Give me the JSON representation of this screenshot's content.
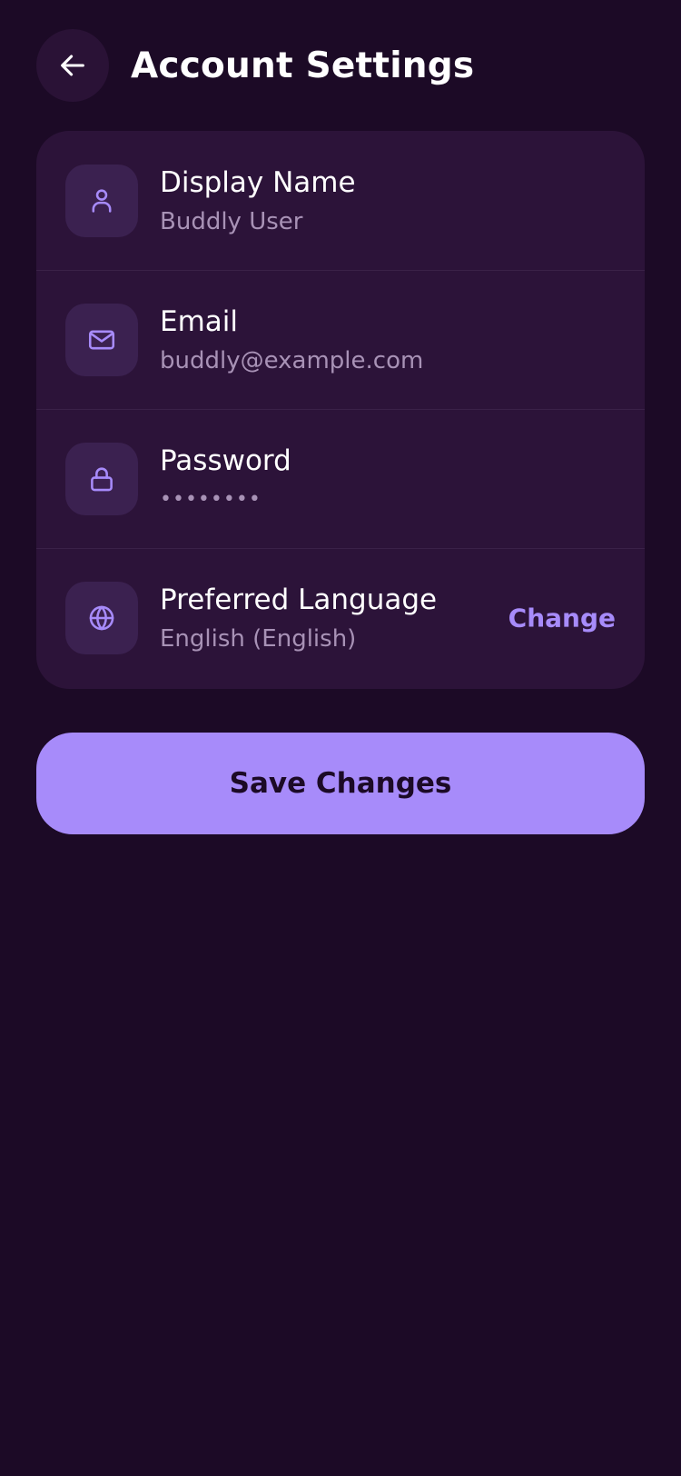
{
  "header": {
    "title": "Account Settings",
    "back_icon": "arrow-left-icon"
  },
  "settings": {
    "items": [
      {
        "icon": "user-icon",
        "label": "Display Name",
        "value": "Buddly User"
      },
      {
        "icon": "mail-icon",
        "label": "Email",
        "value": "buddly@example.com"
      },
      {
        "icon": "lock-icon",
        "label": "Password",
        "value": "••••••••"
      },
      {
        "icon": "globe-icon",
        "label": "Preferred Language",
        "value": "English (English)",
        "action": "Change"
      }
    ]
  },
  "actions": {
    "save_label": "Save Changes"
  },
  "colors": {
    "background": "#1c0a26",
    "card": "#2c1339",
    "accent": "#a78bfa",
    "muted_text": "#a892b6"
  }
}
